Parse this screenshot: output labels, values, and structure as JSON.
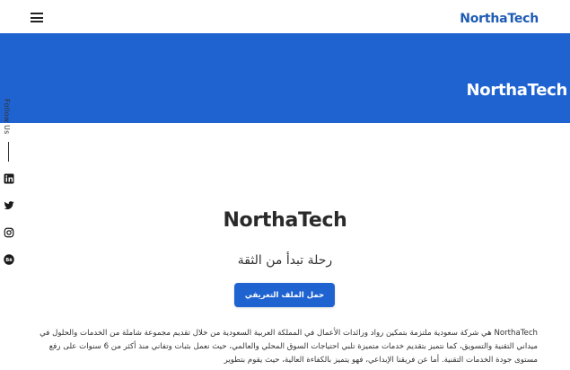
{
  "header": {
    "brand": "NorthaTech",
    "menu_icon": "hamburger-icon"
  },
  "hero": {
    "title": "NorthaTech",
    "background_color": "#1f63d1"
  },
  "sidebar": {
    "follow_label": "Follow Us",
    "social": [
      {
        "name": "linkedin",
        "icon": "linkedin-icon"
      },
      {
        "name": "twitter",
        "icon": "twitter-icon"
      },
      {
        "name": "instagram",
        "icon": "instagram-icon"
      },
      {
        "name": "behance",
        "icon": "behance-icon"
      }
    ]
  },
  "main": {
    "title": "NorthaTech",
    "tagline": "رحلة تبدأ من الثقة",
    "cta_label": "حمل الملف التعريفي",
    "about_text": "NorthaTech هي شركة سعودية ملتزمة بتمكين رواد ورائدات الأعمال في المملكة العربية السعودية من خلال تقديم مجموعة شاملة من الخدمات والحلول في ميداني التقنية والتسويق، كما نتميز بتقديم خدمات متميزة تلبي احتياجات السوق المحلي والعالمي، حيث نعمل بثبات وتفاني منذ أكثر من 6 سنوات على رفع مستوى جودة الخدمات التقنية. أما عن فريقنا الإبداعي، فهو يتميز بالكفاءة العالية، حيث يقوم بتطوير"
  },
  "colors": {
    "accent": "#1f63d1",
    "brand_text": "#1e5bb5"
  }
}
